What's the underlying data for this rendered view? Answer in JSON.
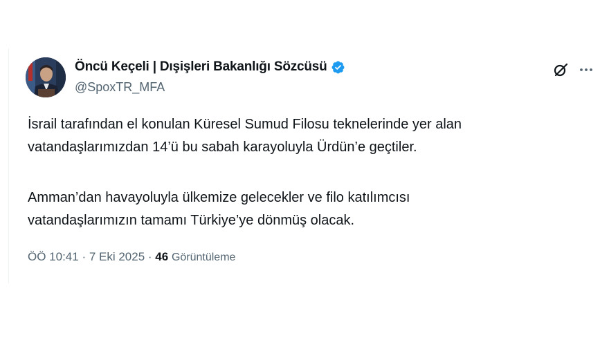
{
  "tweet": {
    "author": {
      "display_name": "Öncü Keçeli | Dışişleri Bakanlığı Sözcüsü",
      "handle": "@SpoxTR_MFA",
      "verified_icon": "verified-badge-icon",
      "verified_color": "#1d9bf0"
    },
    "body": {
      "paragraph1_line1": "İsrail tarafından el konulan Küresel Sumud Filosu teknelerinde yer alan",
      "paragraph1_line2": "vatandaşlarımızdan 14’ü bu sabah karayoluyla Ürdün’e geçtiler.",
      "paragraph2_line1": "Amman’dan havayoluyla ülkemize gelecekler ve filo katılımcısı",
      "paragraph2_line2": "vatandaşlarımızın tamamı Türkiye’ye dönmüş olacak."
    },
    "meta": {
      "time": "ÖÖ 10:41",
      "separator1": " · ",
      "date": "7 Eki 2025",
      "separator2": " · ",
      "views_count": "46",
      "views_label": "Görüntüleme"
    },
    "icons": {
      "grok": "grok-icon",
      "more": "more-icon"
    }
  }
}
